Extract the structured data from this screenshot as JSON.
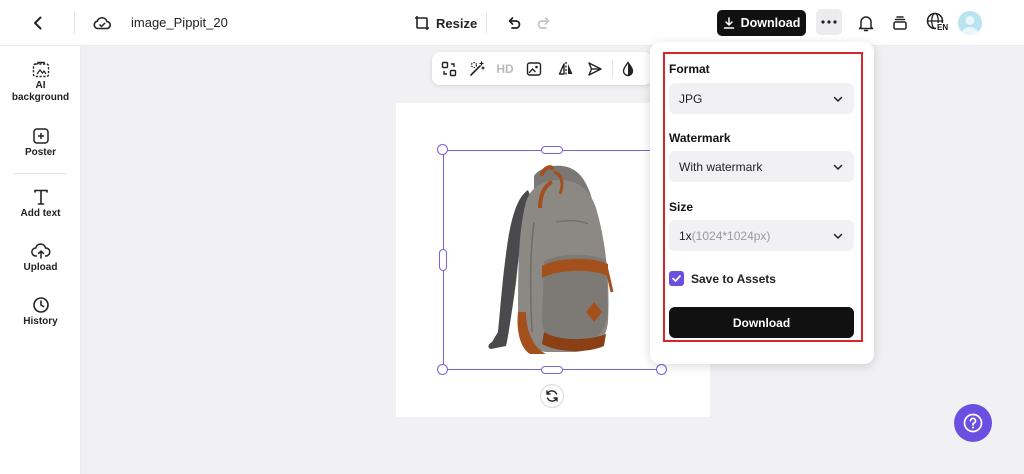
{
  "header": {
    "doc_title": "image_Pippit_20",
    "resize_label": "Resize",
    "download_label": "Download",
    "language_code": "EN"
  },
  "sidebar": {
    "items": [
      {
        "label": "AI background",
        "icon": "ai-background-icon"
      },
      {
        "label": "Poster",
        "icon": "poster-icon"
      },
      {
        "label": "Add text",
        "icon": "text-icon"
      },
      {
        "label": "Upload",
        "icon": "upload-icon"
      },
      {
        "label": "History",
        "icon": "history-icon"
      }
    ]
  },
  "toolbar": {
    "hd_label": "HD"
  },
  "download_panel": {
    "format_label": "Format",
    "format_value": "JPG",
    "watermark_label": "Watermark",
    "watermark_value": "With watermark",
    "size_label": "Size",
    "size_value": "1x",
    "size_detail": "(1024*1024px)",
    "save_to_assets_label": "Save to Assets",
    "save_to_assets_checked": true,
    "download_button_label": "Download"
  },
  "colors": {
    "accent": "#6b4fe0",
    "selection": "#7b61d9",
    "highlight_outline": "#d9262c"
  }
}
